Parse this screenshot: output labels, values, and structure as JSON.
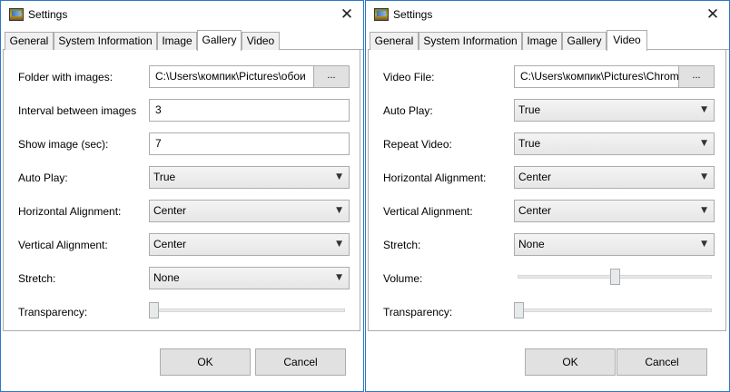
{
  "windows": [
    {
      "title": "Settings",
      "tabs": [
        "General",
        "System Information",
        "Image",
        "Gallery",
        "Video"
      ],
      "selected_tab": "Gallery",
      "fields": {
        "folder_label": "Folder with images:",
        "folder_value": "C:\\Users\\компик\\Pictures\\обои",
        "browse_label": "...",
        "interval_label": "Interval between images",
        "interval_value": "3",
        "show_label": "Show image (sec):",
        "show_value": "7",
        "autoplay_label": "Auto Play:",
        "autoplay_value": "True",
        "halign_label": "Horizontal Alignment:",
        "halign_value": "Center",
        "valign_label": "Vertical Alignment:",
        "valign_value": "Center",
        "stretch_label": "Stretch:",
        "stretch_value": "None",
        "transparency_label": "Transparency:",
        "transparency_level": 0.0
      },
      "buttons": {
        "ok": "OK",
        "cancel": "Cancel"
      }
    },
    {
      "title": "Settings",
      "tabs": [
        "General",
        "System Information",
        "Image",
        "Gallery",
        "Video"
      ],
      "selected_tab": "Video",
      "fields": {
        "video_file_label": "Video File:",
        "video_file_value": "C:\\Users\\компик\\Pictures\\Chrom",
        "browse_label": "...",
        "autoplay_label": "Auto Play:",
        "autoplay_value": "True",
        "repeat_label": "Repeat Video:",
        "repeat_value": "True",
        "halign_label": "Horizontal Alignment:",
        "halign_value": "Center",
        "valign_label": "Vertical Alignment:",
        "valign_value": "Center",
        "stretch_label": "Stretch:",
        "stretch_value": "None",
        "volume_label": "Volume:",
        "volume_level": 0.5,
        "transparency_label": "Transparency:",
        "transparency_level": 0.0
      },
      "buttons": {
        "ok": "OK",
        "cancel": "Cancel"
      }
    }
  ],
  "icons": {
    "app": "settings-app-icon",
    "close": "close-icon",
    "dropdown": "chevron-down-icon"
  }
}
